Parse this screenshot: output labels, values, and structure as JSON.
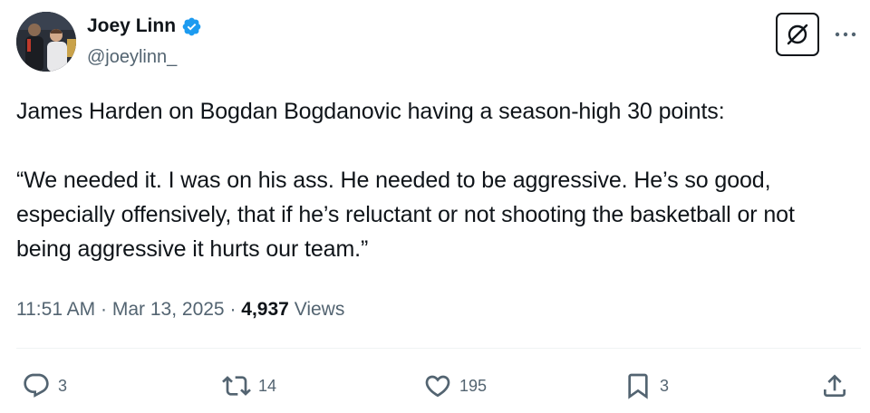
{
  "author": {
    "name": "Joey Linn",
    "handle": "@joeylinn_"
  },
  "tweet": {
    "line1": "James Harden on Bogdan Bogdanovic having a season-high 30 points:",
    "line2": "“We needed it. I was on his ass. He needed to be aggressive. He’s so good, especially offensively, that if he’s reluctant or not shooting the basketball or not being aggressive it hurts our team.”"
  },
  "meta": {
    "time": "11:51 AM",
    "separator": "·",
    "date": "Mar 13, 2025",
    "views_count": "4,937",
    "views_label": "Views"
  },
  "actions": {
    "replies": "3",
    "reposts": "14",
    "likes": "195",
    "bookmarks": "3"
  },
  "icons": {
    "verified": "verified-badge-icon",
    "grok": "grok-icon",
    "more": "more-icon",
    "reply": "reply-icon",
    "repost": "repost-icon",
    "like": "heart-icon",
    "bookmark": "bookmark-icon",
    "share": "share-icon"
  },
  "colors": {
    "verified_blue": "#1d9bf0",
    "text_primary": "#0f1419",
    "text_secondary": "#536471",
    "divider": "#eff3f4"
  }
}
